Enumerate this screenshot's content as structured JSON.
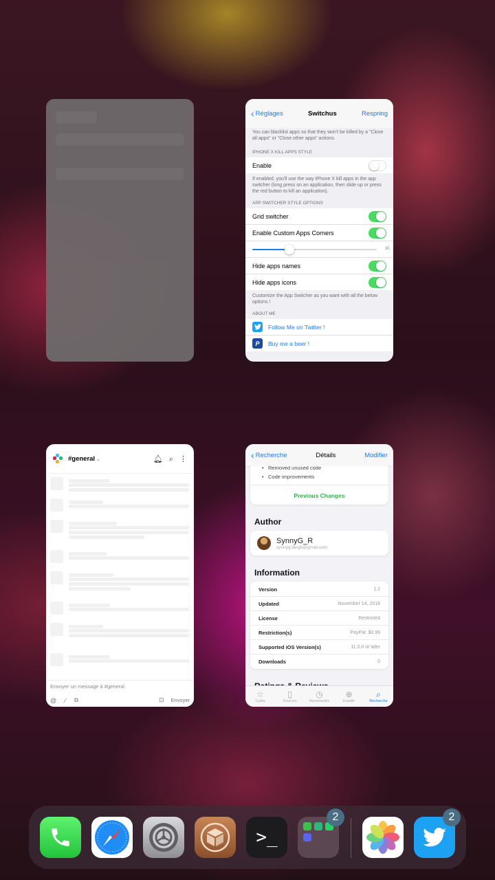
{
  "settings_card": {
    "nav": {
      "back": "Réglages",
      "title": "Switchus",
      "right": "Respring"
    },
    "top_note": "You can blacklist apps so that they won't be killed by a \"Close all apps\" or \"Close other apps\" actions.",
    "kill_header": "IPHONE X KILL APPS STYLE",
    "enable_label": "Enable",
    "enable_on": false,
    "kill_note": "If enabled, you'll use the way iPhone X kill apps in the app switcher (long press on an application, then slide up or press the red button to kill an application).",
    "style_header": "APP SWITCHER STYLE OPTIONS",
    "grid_label": "Grid switcher",
    "corners_label": "Enable Custom Apps Corners",
    "slider_value": 0.3,
    "slider_text": "30.",
    "hide_names_label": "Hide apps names",
    "hide_icons_label": "Hide apps icons",
    "style_note": "Customize the App Switcher as you want with all the below options !",
    "about_header": "ABOUT ME",
    "twitter_link": "Follow Me on Twitter !",
    "beer_link": "Buy me a beer !"
  },
  "slack_card": {
    "channel": "#general",
    "input_placeholder": "Envoyer un message à #general",
    "send_label": "Envoyer"
  },
  "cydia_card": {
    "nav": {
      "back": "Recherche",
      "title": "Détails",
      "right": "Modifier"
    },
    "changes": [
      "Removed unused code",
      "Code improvements"
    ],
    "previous_changes": "Previous Changes",
    "author_header": "Author",
    "author_name": "SynnyG_R",
    "author_email": "synnyg.devjb@gmail.com",
    "info_header": "Information",
    "info_rows": [
      {
        "key": "Version",
        "value": "1.2"
      },
      {
        "key": "Updated",
        "value": "November 14, 2018"
      },
      {
        "key": "License",
        "value": "Restricted"
      },
      {
        "key": "Restriction(s)",
        "value": "PayPal: $0.99"
      },
      {
        "key": "Supported iOS Version(s)",
        "value": "11.0.0 or later"
      },
      {
        "key": "Downloads",
        "value": "0"
      }
    ],
    "ratings_header": "Ratings & Reviews",
    "tabs": [
      "Cydia",
      "Sources",
      "Nouveautés",
      "Installé",
      "Recherche"
    ]
  },
  "dock": {
    "folder_badge": "2",
    "twitter_badge": "2",
    "terminal_glyph": ">_"
  },
  "colors": {
    "ios_blue": "#1a7cf5",
    "toggle_green": "#4cd964",
    "cydia_green": "#34b24a",
    "badge": "#4a6e86"
  }
}
